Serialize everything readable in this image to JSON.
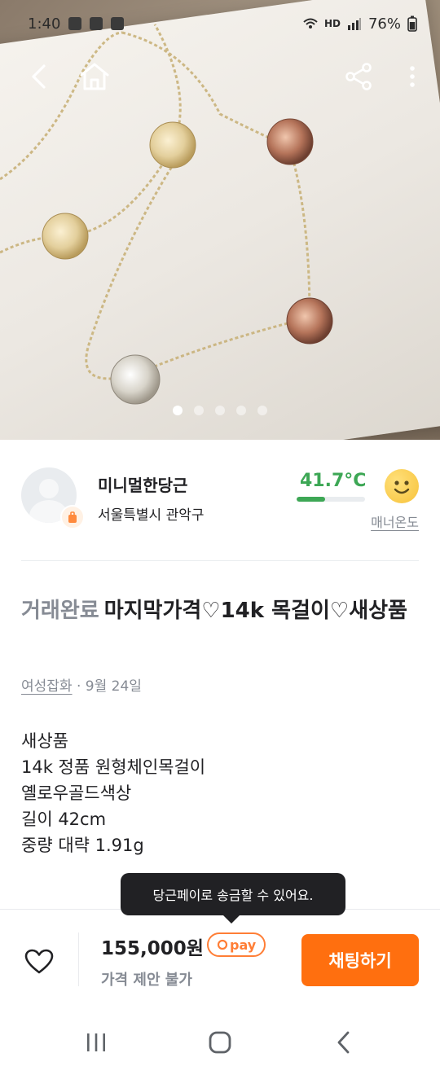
{
  "status_bar": {
    "time": "1:40",
    "network": "HD",
    "battery": "76%"
  },
  "gallery": {
    "image_count": 5,
    "active_index": 0
  },
  "seller": {
    "name": "미니멀한당근",
    "location": "서울특별시 관악구",
    "manner_temp": "41.7°C",
    "manner_temp_value": 41.7,
    "manner_label": "매너온도"
  },
  "listing": {
    "status": "거래완료",
    "title": "마지막가격♡14k 목걸이♡새상품",
    "category": "여성잡화",
    "date": " · 9월 24일",
    "description": [
      "새상품",
      "14k 정품 원형체인목걸이",
      "옐로우골드색상",
      "길이 42cm",
      "중량 대략 1.91g"
    ]
  },
  "tooltip": {
    "text": "당근페이로 송금할 수 있어요."
  },
  "purchase": {
    "price": "155,000원",
    "pay_badge": "pay",
    "negotiation": "가격 제안 불가",
    "chat_button": "채팅하기"
  },
  "colors": {
    "accent": "#ff6f0f",
    "temp_green": "#3da755",
    "muted": "#868b94"
  }
}
